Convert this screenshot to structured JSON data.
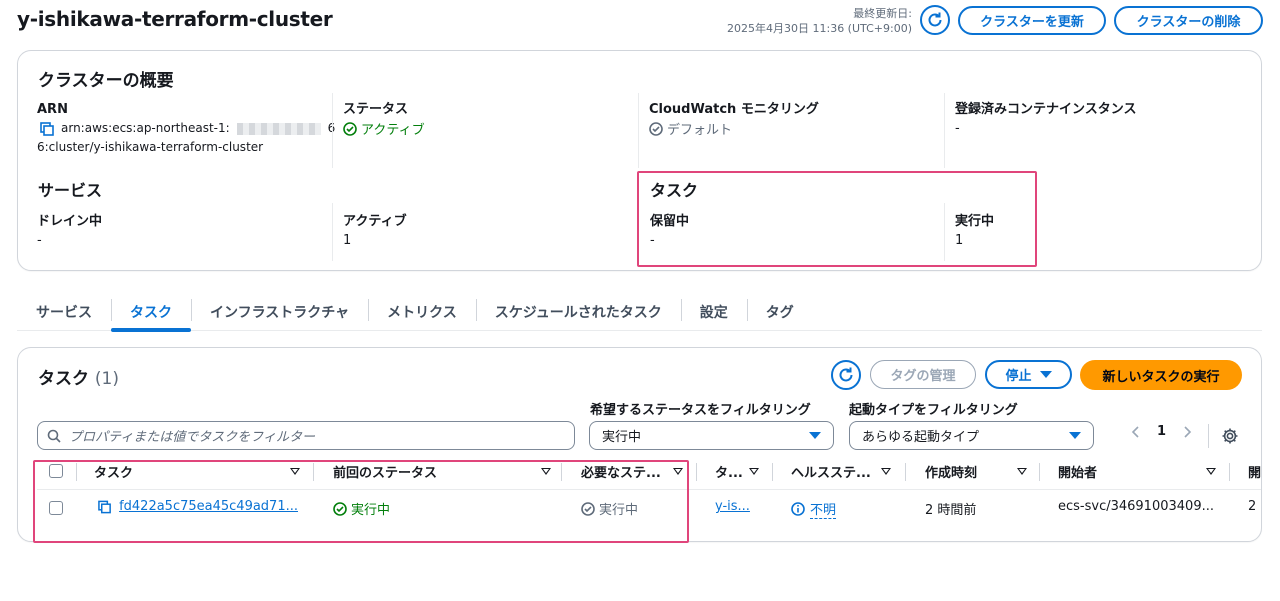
{
  "header": {
    "title": "y-ishikawa-terraform-cluster",
    "updated_label": "最終更新日:",
    "updated_value": "2025年4月30日 11:36 (UTC+9:00)",
    "update_cluster_label": "クラスターを更新",
    "delete_cluster_label": "クラスターの削除"
  },
  "overview": {
    "title": "クラスターの概要",
    "arn_label": "ARN",
    "arn_line1": "arn:aws:ecs:ap-northeast-1:",
    "arn_line1_end": "6",
    "arn_line2": "6:cluster/y-ishikawa-terraform-cluster",
    "status_label": "ステータス",
    "status_value": "アクティブ",
    "cloudwatch_label": "CloudWatch モニタリング",
    "cloudwatch_value": "デフォルト",
    "registered_label": "登録済みコンテナインスタンス",
    "registered_value": "-",
    "services_title": "サービス",
    "draining_label": "ドレイン中",
    "draining_value": "-",
    "active_label": "アクティブ",
    "active_value": "1",
    "tasks_title": "タスク",
    "pending_label": "保留中",
    "pending_value": "-",
    "running_label": "実行中",
    "running_value": "1"
  },
  "tabs": [
    "サービス",
    "タスク",
    "インフラストラクチャ",
    "メトリクス",
    "スケジュールされたタスク",
    "設定",
    "タグ"
  ],
  "active_tab": "タスク",
  "tasks": {
    "title": "タスク",
    "count": "(1)",
    "manage_tags_label": "タグの管理",
    "stop_label": "停止",
    "run_new_label": "新しいタスクの実行",
    "search_placeholder": "プロパティまたは値でタスクをフィルター",
    "desired_filter_label": "希望するステータスをフィルタリング",
    "desired_filter_value": "実行中",
    "launch_filter_label": "起動タイプをフィルタリング",
    "launch_filter_value": "あらゆる起動タイプ",
    "page": "1",
    "columns": [
      "タスク",
      "前回のステータス",
      "必要なステ...",
      "タ...",
      "ヘルスステ...",
      "作成時刻",
      "開始者",
      "開"
    ],
    "rows": [
      {
        "task": "fd422a5c75ea45c49ad71...",
        "last_status": "実行中",
        "desired_status": "実行中",
        "task_def": "y-is...",
        "health": "不明",
        "created": "2 時間前",
        "started_by": "ecs-svc/34691003409...",
        "extra": "2"
      }
    ]
  },
  "colors": {
    "accent": "#0972d3",
    "success": "#037f0c",
    "highlight": "#e0457b",
    "primary_button": "#ff9900"
  },
  "icons": [
    "refresh-icon",
    "copy-icon",
    "check-circle-icon",
    "search-icon",
    "settings-gear-icon",
    "info-icon",
    "chevron-left-icon",
    "chevron-right-icon",
    "caret-down-icon"
  ]
}
